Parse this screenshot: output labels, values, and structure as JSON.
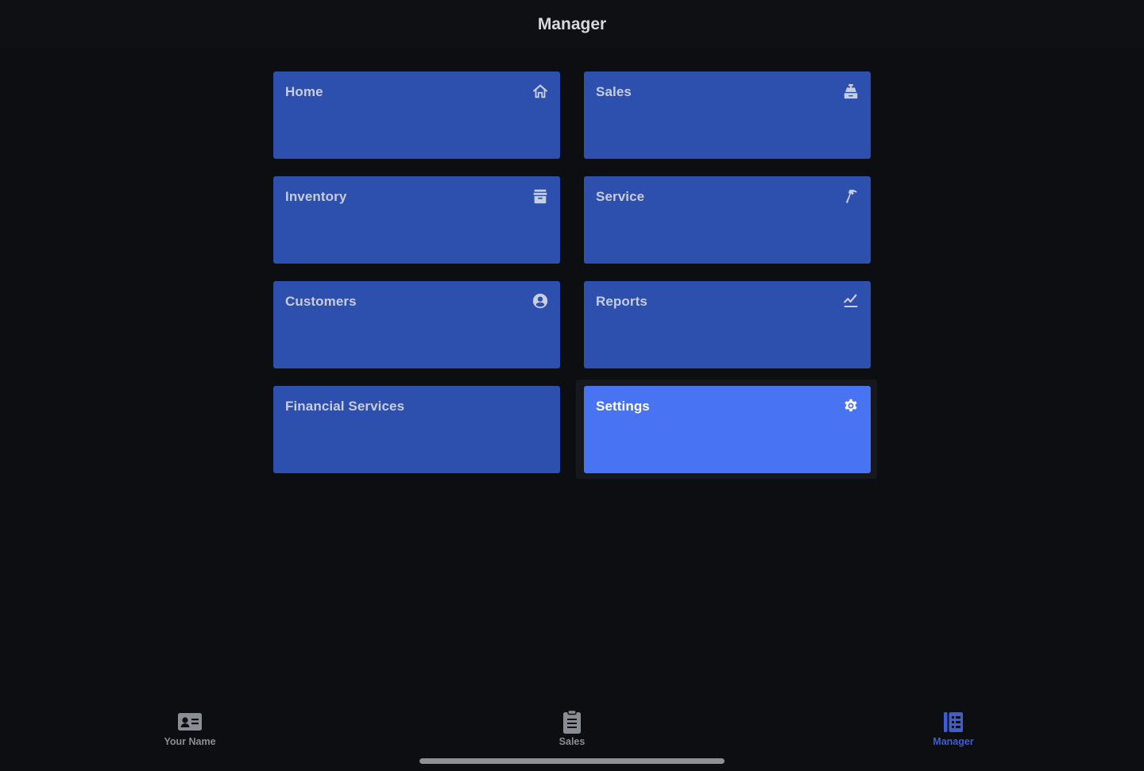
{
  "header": {
    "title": "Manager"
  },
  "tiles": [
    {
      "label": "Home",
      "icon": "home-icon"
    },
    {
      "label": "Sales",
      "icon": "cash-register-icon"
    },
    {
      "label": "Inventory",
      "icon": "archive-box-icon"
    },
    {
      "label": "Service",
      "icon": "hammer-icon"
    },
    {
      "label": "Customers",
      "icon": "user-circle-icon"
    },
    {
      "label": "Reports",
      "icon": "chart-line-icon"
    },
    {
      "label": "Financial Services",
      "icon": ""
    },
    {
      "label": "Settings",
      "icon": "gear-icon",
      "active": true
    }
  ],
  "tabbar": {
    "items": [
      {
        "label": "Your Name",
        "icon": "id-card-icon"
      },
      {
        "label": "Sales",
        "icon": "clipboard-icon"
      },
      {
        "label": "Manager",
        "icon": "book-icon",
        "selected": true
      }
    ]
  },
  "colors": {
    "background": "#0c0e12",
    "tile": "#2d4fad",
    "tile_active": "#4873f2",
    "tab_selected": "#3c5ed1",
    "tab_inactive": "#8a8d93"
  }
}
